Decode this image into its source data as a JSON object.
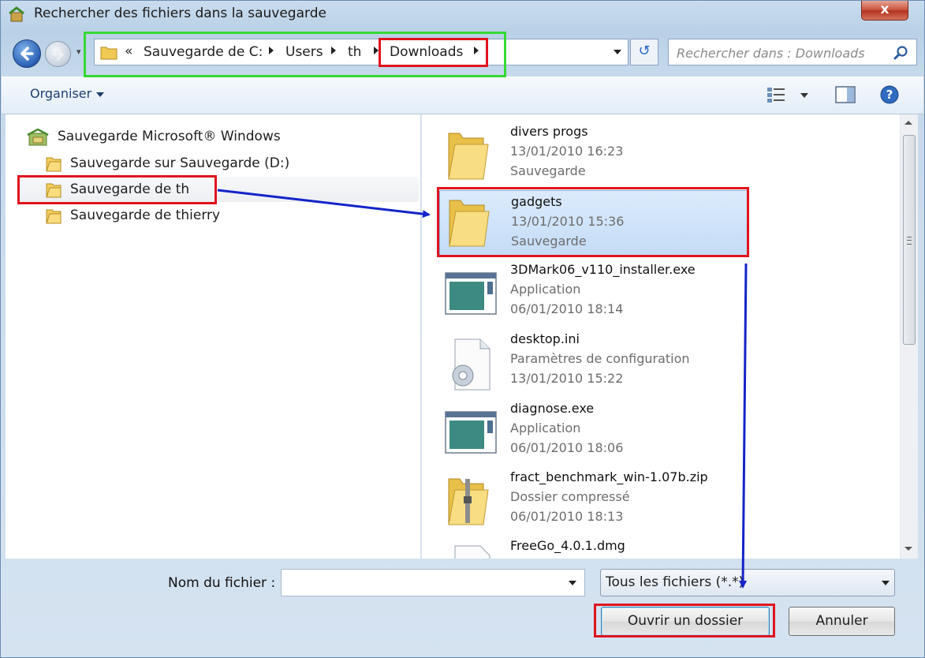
{
  "window": {
    "title": "Rechercher des fichiers dans la sauvegarde",
    "close_label": "x"
  },
  "navigation": {
    "recent_label": "▾",
    "breadcrumb": {
      "overflow": "«",
      "items": [
        "Sauvegarde de C:",
        "Users",
        "th",
        "Downloads"
      ]
    },
    "refresh_label": "↺",
    "search": {
      "placeholder": "Rechercher dans : Downloads"
    }
  },
  "toolbar": {
    "organize_label": "Organiser"
  },
  "nav_pane": {
    "root": "Sauvegarde Microsoft® Windows",
    "items": [
      {
        "label": "Sauvegarde sur Sauvegarde (D:)"
      },
      {
        "label": "Sauvegarde de th",
        "selected": true
      },
      {
        "label": "Sauvegarde de thierry"
      }
    ]
  },
  "files": [
    {
      "name": "divers progs",
      "line2": "13/01/2010 16:23",
      "line3": "Sauvegarde",
      "icon": "folder-icon"
    },
    {
      "name": "gadgets",
      "line2": "13/01/2010 15:36",
      "line3": "Sauvegarde",
      "icon": "folder-icon",
      "selected": true
    },
    {
      "name": "3DMark06_v110_installer.exe",
      "line2": "Application",
      "line3": "06/01/2010 18:14",
      "icon": "application-icon"
    },
    {
      "name": "desktop.ini",
      "line2": "Paramètres de configuration",
      "line3": "13/01/2010 15:22",
      "icon": "config-file-icon"
    },
    {
      "name": "diagnose.exe",
      "line2": "Application",
      "line3": "06/01/2010 18:06",
      "icon": "application-icon"
    },
    {
      "name": "fract_benchmark_win-1.07b.zip",
      "line2": "Dossier compressé",
      "line3": "06/01/2010 18:13",
      "icon": "zip-folder-icon"
    },
    {
      "name": "FreeGo_4.0.1.dmg",
      "line2": "",
      "line3": "",
      "icon": "file-icon"
    }
  ],
  "bottom": {
    "filename_label": "Nom du fichier :",
    "filename_value": "",
    "filetype_value": "Tous les fichiers (*.*)",
    "open_label": "Ouvrir un dossier",
    "cancel_label": "Annuler"
  },
  "colors": {
    "annotation_red": "#e0141e",
    "annotation_green": "#35d935",
    "annotation_arrow": "#1424c8",
    "selection": "#c4dcf6"
  }
}
